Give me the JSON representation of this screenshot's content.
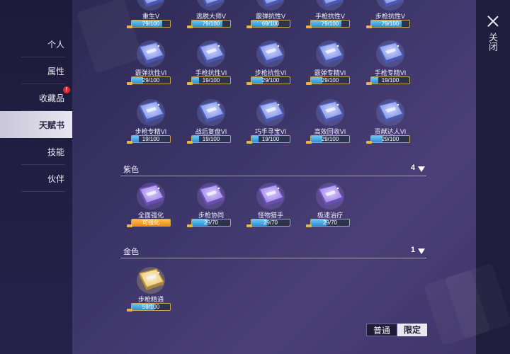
{
  "sidebar": {
    "items": [
      {
        "label": "个人",
        "active": false
      },
      {
        "label": "属性",
        "active": false
      },
      {
        "label": "收藏品",
        "active": false,
        "badge": "!"
      },
      {
        "label": "天赋书",
        "active": true
      },
      {
        "label": "技能",
        "active": false
      },
      {
        "label": "伙伴",
        "active": false
      }
    ]
  },
  "close": {
    "label": "关闭"
  },
  "sections": [
    {
      "label": "紫色",
      "count": "4"
    },
    {
      "label": "金色",
      "count": "1"
    }
  ],
  "cards": [
    {
      "name": "重生V",
      "progress": "79/100",
      "fill": 0.79,
      "tier": "blue"
    },
    {
      "name": "逃脱大师V",
      "progress": "79/100",
      "fill": 0.79,
      "tier": "blue"
    },
    {
      "name": "霰弹抗性V",
      "progress": "69/100",
      "fill": 0.69,
      "tier": "blue"
    },
    {
      "name": "手枪抗性V",
      "progress": "79/100",
      "fill": 0.79,
      "tier": "blue"
    },
    {
      "name": "步枪抗性V",
      "progress": "79/100",
      "fill": 0.79,
      "tier": "blue"
    },
    {
      "name": "霰弹抗性VI",
      "progress": "29/100",
      "fill": 0.29,
      "tier": "blue"
    },
    {
      "name": "手枪抗性VI",
      "progress": "19/100",
      "fill": 0.19,
      "tier": "blue"
    },
    {
      "name": "步枪抗性VI",
      "progress": "29/100",
      "fill": 0.29,
      "tier": "blue"
    },
    {
      "name": "霰弹专精VI",
      "progress": "29/100",
      "fill": 0.29,
      "tier": "blue"
    },
    {
      "name": "手枪专精VI",
      "progress": "19/100",
      "fill": 0.19,
      "tier": "blue"
    },
    {
      "name": "步枪专精VI",
      "progress": "19/100",
      "fill": 0.19,
      "tier": "blue"
    },
    {
      "name": "战后复盘VI",
      "progress": "19/100",
      "fill": 0.19,
      "tier": "blue"
    },
    {
      "name": "巧手寻宝VI",
      "progress": "19/100",
      "fill": 0.19,
      "tier": "blue"
    },
    {
      "name": "高效回收VI",
      "progress": "29/100",
      "fill": 0.29,
      "tier": "blue"
    },
    {
      "name": "贡献达人VI",
      "progress": "29/100",
      "fill": 0.29,
      "tier": "blue"
    },
    {
      "name": "全面强化",
      "progress": "可强化",
      "fill": 1.0,
      "tier": "purple",
      "bar": "gold"
    },
    {
      "name": "步枪协同",
      "progress": "29/70",
      "fill": 0.41,
      "tier": "purple"
    },
    {
      "name": "怪物猎手",
      "progress": "29/70",
      "fill": 0.41,
      "tier": "purple"
    },
    {
      "name": "极速治疗",
      "progress": "29/70",
      "fill": 0.41,
      "tier": "purple"
    },
    {
      "name": "步枪精通",
      "progress": "59/100",
      "fill": 0.59,
      "tier": "gold"
    }
  ],
  "mode": {
    "normal": "普通",
    "limited": "限定"
  },
  "colors": {
    "blue_book": "#8fa0e8",
    "purple_book": "#a38ad8",
    "gold_book": "#e8c878",
    "badge": "#e0262f"
  }
}
